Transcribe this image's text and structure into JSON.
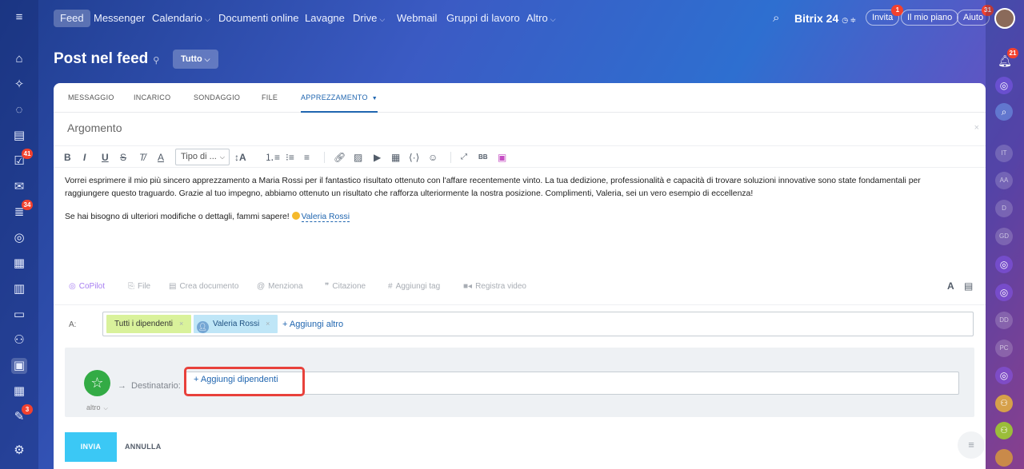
{
  "nav": {
    "items": [
      "Feed",
      "Messenger",
      "Calendario",
      "Documenti online",
      "Lavagne",
      "Drive",
      "Webmail",
      "Gruppi di lavoro",
      "Altro"
    ],
    "brand": "Bitrix 24",
    "invite_label": "Invita",
    "invite_badge": "1",
    "my_plan_label": "Il mio piano",
    "help_label": "Aiuto",
    "help_badge": "31"
  },
  "left_sidebar": {
    "badges": {
      "tasks": "41",
      "feed": "34",
      "approvals": "3"
    }
  },
  "right_sidebar": {
    "notification_badge": "21",
    "contacts": [
      "IT",
      "AA",
      "D",
      "GD",
      "DD",
      "PC"
    ]
  },
  "page": {
    "title": "Post nel feed",
    "filter_label": "Tutto"
  },
  "composer": {
    "tabs": [
      "MESSAGGIO",
      "INCARICO",
      "SONDAGGIO",
      "FILE",
      "APPREZZAMENTO"
    ],
    "subject_placeholder": "Argomento",
    "font_select": "Tipo di ...",
    "body_paragraph_1": "Vorrei esprimere il mio più sincero apprezzamento a Maria Rossi per il fantastico risultato ottenuto con l'affare recentemente vinto. La tua dedizione, professionalità e capacità di trovare soluzioni innovative sono state fondamentali per raggiungere questo traguardo. Grazie al tuo impegno, abbiamo ottenuto un risultato che rafforza ulteriormente la nostra posizione. Complimenti, Valeria, sei un vero esempio di eccellenza!",
    "body_paragraph_2": "Se hai bisogno di ulteriori modifiche o dettagli, fammi sapere!",
    "mention": "Valeria Rossi",
    "tools": [
      "CoPilot",
      "File",
      "Crea documento",
      "Menziona",
      "Citazione",
      "Aggiungi tag",
      "Registra video"
    ],
    "to_label": "A:",
    "recipients": [
      "Tutti i dipendenti",
      "Valeria Rossi"
    ],
    "add_more": "+ Aggiungi altro",
    "badge_type": "altro",
    "destinatario_label": "Destinatario:",
    "add_employees": "+ Aggiungi dipendenti",
    "send_label": "INVIA",
    "cancel_label": "ANNULLA"
  }
}
